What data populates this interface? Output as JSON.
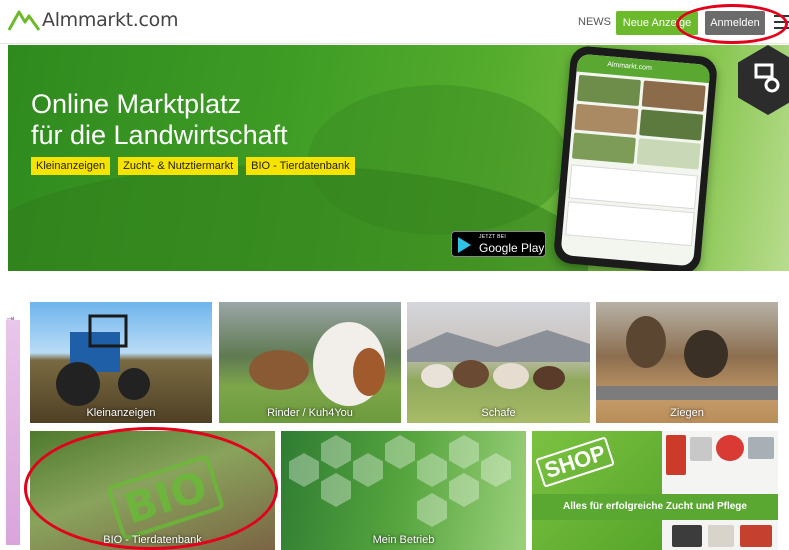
{
  "header": {
    "logo_text": "Almmarkt.com",
    "news_label": "NEWS",
    "neue_anzeige_label": "Neue Anzeige",
    "anmelden_label": "Anmelden"
  },
  "hero": {
    "title_line1": "Online Marktplatz",
    "title_line2": "für die Landwirtschaft",
    "tags": [
      "Kleinanzeigen",
      "Zucht- & Nutztiermarkt",
      "BIO - Tierdatenbank"
    ],
    "play_badge_small": "JETZT BEI",
    "play_badge_big": "Google Play",
    "phone_brand": "Almmarkt.com"
  },
  "categories": {
    "row1": [
      "Kleinanzeigen",
      "Rinder / Kuh4You",
      "Schafe",
      "Ziegen"
    ],
    "row2": [
      "BIO - Tierdatenbank",
      "Mein Betrieb",
      "Alles für erfolgreiche Zucht und Pflege"
    ]
  },
  "shop": {
    "sign": "SHOP"
  },
  "bio_tile": {
    "overlay_word": "BIO"
  },
  "colors": {
    "brand_green": "#6cba2b",
    "tag_yellow": "#f7e300",
    "anmelden_gray": "#6b6b6b",
    "highlight_red": "#e3001b"
  }
}
